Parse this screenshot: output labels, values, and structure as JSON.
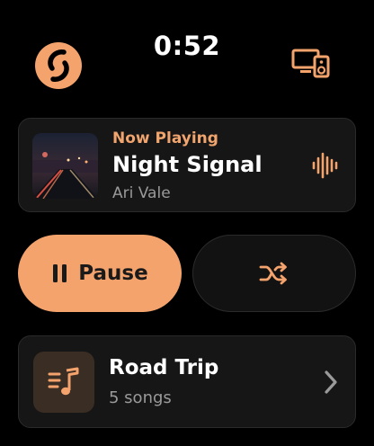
{
  "status": {
    "time": "0:52"
  },
  "header": {
    "logo_icon": "sync-loop-logo-icon",
    "device_icon": "devices-speaker-icon"
  },
  "now_playing": {
    "label": "Now Playing",
    "title": "Night Signal",
    "artist": "Ari Vale",
    "art_icon": "album-art-night-road",
    "indicator_icon": "audio-wave-icon"
  },
  "controls": {
    "pause_label": "Pause",
    "pause_icon": "pause-icon",
    "shuffle_icon": "shuffle-icon"
  },
  "playlist": {
    "title": "Road Trip",
    "subtitle": "5 songs",
    "icon": "playlist-music-icon",
    "chevron_icon": "chevron-right-icon"
  },
  "colors": {
    "accent": "#f5a36d",
    "accent_text": "#f0a46e",
    "card_bg": "#161616",
    "background": "#000000"
  }
}
